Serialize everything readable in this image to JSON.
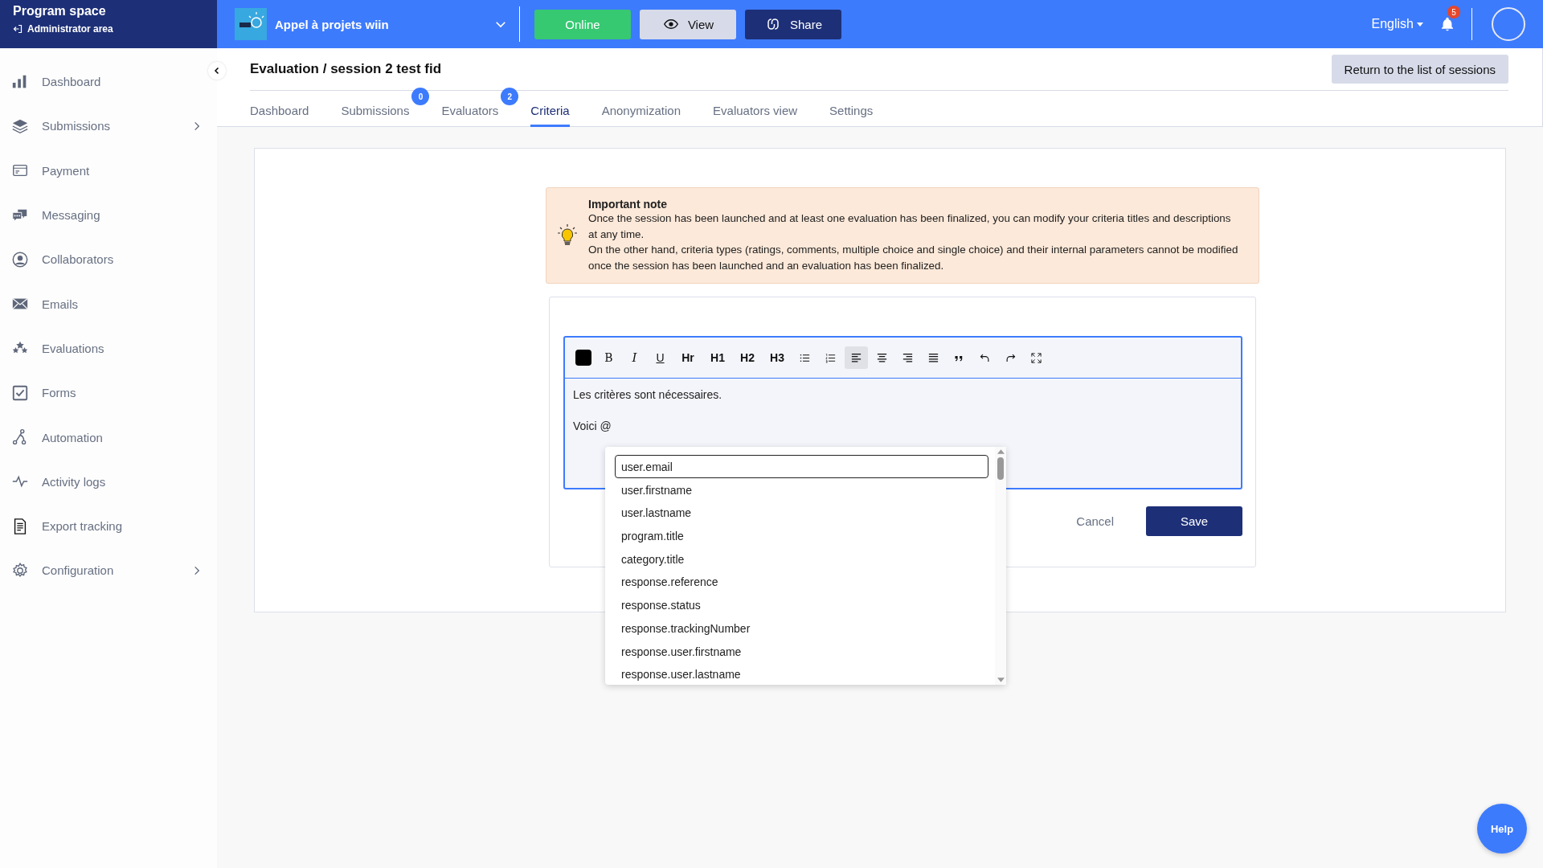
{
  "sidebar": {
    "title": "Program space",
    "subtitle": "Administrator area",
    "items": [
      {
        "label": "Dashboard",
        "has_submenu": false
      },
      {
        "label": "Submissions",
        "has_submenu": true
      },
      {
        "label": "Payment",
        "has_submenu": false
      },
      {
        "label": "Messaging",
        "has_submenu": false
      },
      {
        "label": "Collaborators",
        "has_submenu": false
      },
      {
        "label": "Emails",
        "has_submenu": false
      },
      {
        "label": "Evaluations",
        "has_submenu": false
      },
      {
        "label": "Forms",
        "has_submenu": false
      },
      {
        "label": "Automation",
        "has_submenu": false
      },
      {
        "label": "Activity logs",
        "has_submenu": false
      },
      {
        "label": "Export tracking",
        "has_submenu": false
      },
      {
        "label": "Configuration",
        "has_submenu": true
      }
    ]
  },
  "topbar": {
    "program": "Appel à projets wiin",
    "buttons": [
      {
        "label": "Online",
        "kind": "status"
      },
      {
        "label": "View",
        "kind": "view"
      },
      {
        "label": "Share",
        "kind": "share"
      }
    ],
    "language": "English",
    "notifications": "5"
  },
  "page": {
    "title": "Evaluation / session 2 test fid",
    "return_button": "Return to the list of sessions",
    "tabs": [
      {
        "label": "Dashboard",
        "selected": false
      },
      {
        "label": "Submissions",
        "badge": "0",
        "selected": false
      },
      {
        "label": "Evaluators",
        "badge": "2",
        "selected": false
      },
      {
        "label": "Criteria",
        "selected": true
      },
      {
        "label": "Anonymization",
        "selected": false
      },
      {
        "label": "Evaluators view",
        "selected": false
      },
      {
        "label": "Settings",
        "selected": false
      }
    ]
  },
  "note": {
    "title": "Important note",
    "lines": [
      "Once the session has been launched and at least one evaluation has been finalized, you can modify your criteria titles and descriptions at any time.",
      "On the other hand, criteria types (ratings, comments, multiple choice and single choice) and their internal parameters cannot be modified once the session has been launched and an evaluation has been finalized."
    ]
  },
  "editor": {
    "toolbar": [
      {
        "kind": "swatch",
        "selected": false
      },
      {
        "kind": "bold",
        "label": "B",
        "selected": false
      },
      {
        "kind": "italic",
        "label": "I",
        "selected": false
      },
      {
        "kind": "underline",
        "label": "U",
        "selected": false
      },
      {
        "kind": "heading",
        "label": "Hr",
        "selected": false
      },
      {
        "kind": "heading",
        "label": "H1",
        "selected": false
      },
      {
        "kind": "heading",
        "label": "H2",
        "selected": false
      },
      {
        "kind": "heading",
        "label": "H3",
        "selected": false
      },
      {
        "kind": "bullet-list",
        "selected": false
      },
      {
        "kind": "number-list",
        "selected": false
      },
      {
        "kind": "align-left",
        "selected": true
      },
      {
        "kind": "align-center",
        "selected": false
      },
      {
        "kind": "align-right",
        "selected": false
      },
      {
        "kind": "justify",
        "selected": false
      },
      {
        "kind": "quote",
        "selected": false
      },
      {
        "kind": "undo",
        "selected": false
      },
      {
        "kind": "redo",
        "selected": false
      },
      {
        "kind": "fullscreen",
        "selected": false
      }
    ],
    "paragraphs": [
      "Les critères sont nécessaires.",
      "Voici  @"
    ],
    "suggestions": [
      {
        "label": "user.email",
        "selected": true
      },
      {
        "label": "user.firstname",
        "selected": false
      },
      {
        "label": "user.lastname",
        "selected": false
      },
      {
        "label": "program.title",
        "selected": false
      },
      {
        "label": "category.title",
        "selected": false
      },
      {
        "label": "response.reference",
        "selected": false
      },
      {
        "label": "response.status",
        "selected": false
      },
      {
        "label": "response.trackingNumber",
        "selected": false
      },
      {
        "label": "response.user.firstname",
        "selected": false
      },
      {
        "label": "response.user.lastname",
        "selected": false
      }
    ],
    "cancel": "Cancel",
    "save": "Save"
  },
  "help": "Help"
}
